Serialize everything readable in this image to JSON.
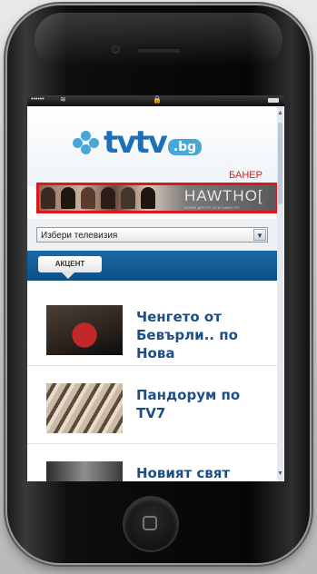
{
  "status_bar": {
    "carrier": "••••••",
    "wifi_icon": "wifi-icon",
    "lock_icon": "lock-icon",
    "battery_icon": "battery-icon"
  },
  "header": {
    "logo_text": "tvtv",
    "logo_domain": ".bg"
  },
  "banner": {
    "label": "БАНЕР",
    "ad_text": "HAWTHO[",
    "ad_subtext": "ВСЕКИ ДЕН ОТ 20:30 САМО ПО"
  },
  "tv_select": {
    "value": "Избери телевизия"
  },
  "tab": {
    "label": "АКЦЕНТ"
  },
  "articles": [
    {
      "title": "Ченгето от Бевърли.. по Нова"
    },
    {
      "title": "Пандорум по TV7"
    },
    {
      "title": "Новият свят"
    }
  ],
  "colors": {
    "accent": "#1d6fb6",
    "banner_border": "#e0161c",
    "title": "#1d4f86",
    "tabbar": "#1b6aa6"
  }
}
